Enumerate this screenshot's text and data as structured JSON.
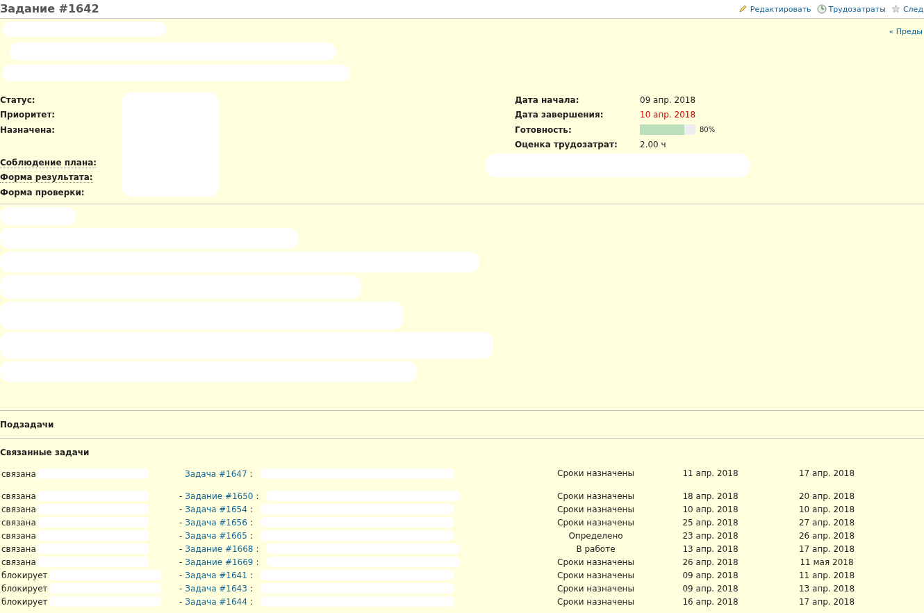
{
  "header": {
    "title": "Задание #1642",
    "actions": [
      {
        "kind": "edit",
        "label": "Редактировать"
      },
      {
        "kind": "time",
        "label": "Трудозатраты"
      },
      {
        "kind": "watch",
        "label": "След"
      }
    ]
  },
  "nav": {
    "previous": "« Преды"
  },
  "attributes_left": [
    {
      "label": "Статус:",
      "dotted": false
    },
    {
      "label": "Приоритет:",
      "dotted": false
    },
    {
      "label": "Назначена:",
      "dotted": false,
      "gap_after": true
    },
    {
      "label": "Соблюдение плана:",
      "dotted": true
    },
    {
      "label": "Форма результата:",
      "dotted": true
    },
    {
      "label": "Форма проверки:",
      "dotted": false
    }
  ],
  "attributes_right": [
    {
      "kind": "text",
      "label": "Дата начала:",
      "value": "09 апр. 2018",
      "overdue": false
    },
    {
      "kind": "text",
      "label": "Дата завершения:",
      "value": "10 апр. 2018",
      "overdue": true
    },
    {
      "kind": "progress",
      "label": "Готовность:",
      "level": 0.8,
      "value": "80%"
    },
    {
      "kind": "text",
      "label": "Оценка трудозатрат:",
      "value": "2.00 ч",
      "overdue": false
    }
  ],
  "subtasks": {
    "title": "Подзадачи"
  },
  "relations": {
    "title": "Связанные задачи",
    "rows": [
      {
        "relation": "связана",
        "dash": "",
        "link": "Задача #1647",
        "colon": ":",
        "status": "Сроки назначены",
        "start": "11 апр. 2018",
        "due": "17 апр. 2018",
        "tall": true
      },
      {
        "relation": "связана",
        "dash": "-",
        "link": "Задание #1650",
        "colon": ":",
        "status": "Сроки назначены",
        "start": "18 апр. 2018",
        "due": "20 апр. 2018",
        "tall": false
      },
      {
        "relation": "связана",
        "dash": "-",
        "link": "Задача #1654",
        "colon": ":",
        "status": "Сроки назначены",
        "start": "10 апр. 2018",
        "due": "10 апр. 2018",
        "tall": false
      },
      {
        "relation": "связана",
        "dash": "-",
        "link": "Задача #1656",
        "colon": ":",
        "status": "Сроки назначены",
        "start": "25 апр. 2018",
        "due": "27 апр. 2018",
        "tall": false
      },
      {
        "relation": "связана",
        "dash": "-",
        "link": "Задача #1665",
        "colon": ":",
        "status": "Определено",
        "start": "23 апр. 2018",
        "due": "26 апр. 2018",
        "tall": false
      },
      {
        "relation": "связана",
        "dash": "-",
        "link": "Задание #1668",
        "colon": ":",
        "status": "В работе",
        "start": "13 апр. 2018",
        "due": "17 апр. 2018",
        "tall": false
      },
      {
        "relation": "связана",
        "dash": "-",
        "link": "Задание #1669",
        "colon": ":",
        "status": "Сроки назначены",
        "start": "26 апр. 2018",
        "due": "11 мая 2018",
        "tall": false
      },
      {
        "relation": "блокирует",
        "dash": "-",
        "link": "Задача #1641",
        "colon": ":",
        "status": "Сроки назначены",
        "start": "09 апр. 2018",
        "due": "11 апр. 2018",
        "tall": false
      },
      {
        "relation": "блокирует",
        "dash": "-",
        "link": "Задача #1643",
        "colon": ":",
        "status": "Сроки назначены",
        "start": "09 апр. 2018",
        "due": "13 апр. 2018",
        "tall": false
      },
      {
        "relation": "блокирует",
        "dash": "-",
        "link": "Задача #1644",
        "colon": ":",
        "status": "Сроки назначены",
        "start": "16 апр. 2018",
        "due": "17 апр. 2018",
        "tall": false
      }
    ]
  }
}
